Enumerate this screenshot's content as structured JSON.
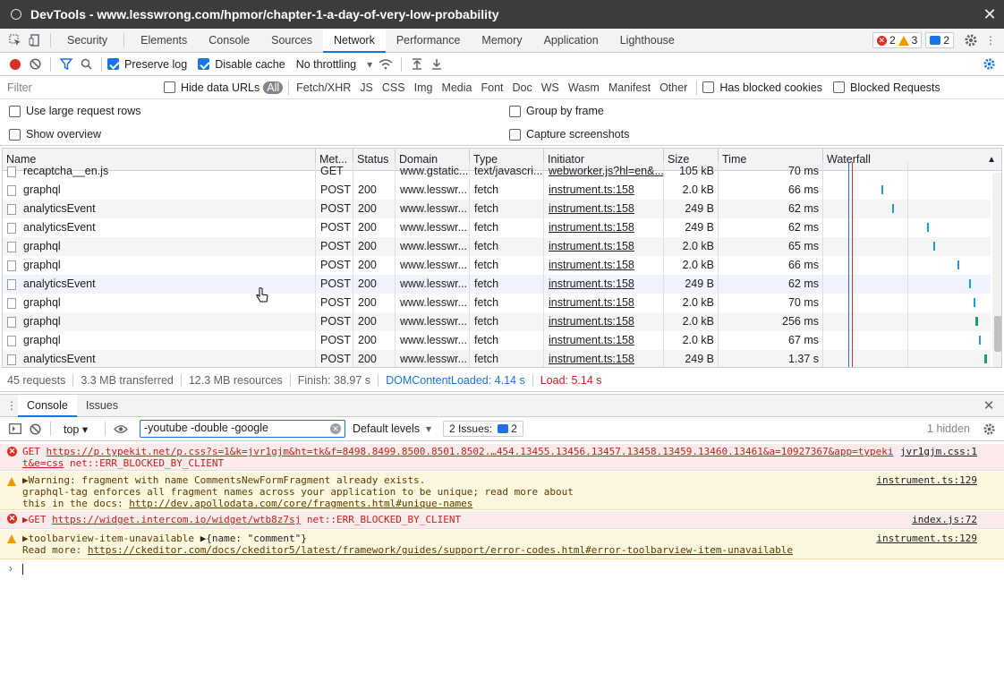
{
  "window": {
    "title": "DevTools - www.lesswrong.com/hpmor/chapter-1-a-day-of-very-low-probability"
  },
  "main_tabs": [
    "Security",
    "Elements",
    "Console",
    "Sources",
    "Network",
    "Performance",
    "Memory",
    "Application",
    "Lighthouse"
  ],
  "active_tab": "Network",
  "badges": {
    "errors": "2",
    "warnings": "3",
    "messages": "2"
  },
  "net_toolbar": {
    "preserve_log": "Preserve log",
    "disable_cache": "Disable cache",
    "throttling": "No throttling"
  },
  "filter_bar": {
    "placeholder": "Filter",
    "hide_data_urls": "Hide data URLs",
    "types": [
      "All",
      "Fetch/XHR",
      "JS",
      "CSS",
      "Img",
      "Media",
      "Font",
      "Doc",
      "WS",
      "Wasm",
      "Manifest",
      "Other"
    ],
    "has_blocked_cookies": "Has blocked cookies",
    "blocked_requests": "Blocked Requests"
  },
  "options": {
    "large_rows": "Use large request rows",
    "show_overview": "Show overview",
    "group_by_frame": "Group by frame",
    "capture_screenshots": "Capture screenshots"
  },
  "columns": [
    "Name",
    "Met...",
    "Status",
    "Domain",
    "Type",
    "Initiator",
    "Size",
    "Time",
    "Waterfall"
  ],
  "partial_row": {
    "name": "recaptcha__en.js",
    "method": "GET",
    "domain": "www.gstatic...",
    "type": "text/javascri...",
    "initiator": "webworker.js?hl=en&...",
    "size": "105 kB",
    "time": "70 ms"
  },
  "rows": [
    {
      "name": "graphql",
      "method": "POST",
      "status": "200",
      "domain": "www.lesswr...",
      "type": "fetch",
      "initiator": "instrument.ts:158",
      "size": "2.0 kB",
      "time": "66 ms",
      "wf": 0.35,
      "wc": "b"
    },
    {
      "name": "analyticsEvent",
      "method": "POST",
      "status": "200",
      "domain": "www.lesswr...",
      "type": "fetch",
      "initiator": "instrument.ts:158",
      "size": "249 B",
      "time": "62 ms",
      "wf": 0.41,
      "wc": "b"
    },
    {
      "name": "analyticsEvent",
      "method": "POST",
      "status": "200",
      "domain": "www.lesswr...",
      "type": "fetch",
      "initiator": "instrument.ts:158",
      "size": "249 B",
      "time": "62 ms",
      "wf": 0.62,
      "wc": "b"
    },
    {
      "name": "graphql",
      "method": "POST",
      "status": "200",
      "domain": "www.lesswr...",
      "type": "fetch",
      "initiator": "instrument.ts:158",
      "size": "2.0 kB",
      "time": "65 ms",
      "wf": 0.66,
      "wc": "b"
    },
    {
      "name": "graphql",
      "method": "POST",
      "status": "200",
      "domain": "www.lesswr...",
      "type": "fetch",
      "initiator": "instrument.ts:158",
      "size": "2.0 kB",
      "time": "66 ms",
      "wf": 0.8,
      "wc": "b"
    },
    {
      "name": "analyticsEvent",
      "method": "POST",
      "status": "200",
      "domain": "www.lesswr...",
      "type": "fetch",
      "initiator": "instrument.ts:158",
      "size": "249 B",
      "time": "62 ms",
      "wf": 0.87,
      "wc": "b"
    },
    {
      "name": "graphql",
      "method": "POST",
      "status": "200",
      "domain": "www.lesswr...",
      "type": "fetch",
      "initiator": "instrument.ts:158",
      "size": "2.0 kB",
      "time": "70 ms",
      "wf": 0.9,
      "wc": "b"
    },
    {
      "name": "graphql",
      "method": "POST",
      "status": "200",
      "domain": "www.lesswr...",
      "type": "fetch",
      "initiator": "instrument.ts:158",
      "size": "2.0 kB",
      "time": "256 ms",
      "wf": 0.91,
      "wc": "g"
    },
    {
      "name": "graphql",
      "method": "POST",
      "status": "200",
      "domain": "www.lesswr...",
      "type": "fetch",
      "initiator": "instrument.ts:158",
      "size": "2.0 kB",
      "time": "67 ms",
      "wf": 0.93,
      "wc": "b"
    },
    {
      "name": "analyticsEvent",
      "method": "POST",
      "status": "200",
      "domain": "www.lesswr...",
      "type": "fetch",
      "initiator": "instrument.ts:158",
      "size": "249 B",
      "time": "1.37 s",
      "wf": 0.96,
      "wc": "g"
    }
  ],
  "summary": {
    "requests": "45 requests",
    "transferred": "3.3 MB transferred",
    "resources": "12.3 MB resources",
    "finish": "Finish: 38.97 s",
    "dcl": "DOMContentLoaded: 4.14 s",
    "load": "Load: 5.14 s"
  },
  "drawer_tabs": [
    "Console",
    "Issues"
  ],
  "console_toolbar": {
    "context": "top",
    "filter": "-youtube -double -google",
    "levels": "Default levels",
    "issues": "2 Issues:",
    "issues_count": "2",
    "hidden": "1 hidden"
  },
  "console": {
    "m1": {
      "prefix": "GET ",
      "url": "https://p.typekit.net/p.css?s=1&k=jvr1gjm&ht=tk&f=8498.8499.8500.8501.8502.…454.13455.13456.13457.13458.13459.13460.13461&a=10927367&app=typeki",
      "url2": "t&e=css",
      "tail": " net::ERR_BLOCKED_BY_CLIENT",
      "src": "jvr1gjm.css:1"
    },
    "m2": {
      "l1": "▶Warning: fragment with name CommentsNewFormFragment already exists.",
      "l2": "graphql-tag enforces all fragment names across your application to be unique; read more about",
      "l3": "this in the docs: ",
      "link": "http://dev.apollodata.com/core/fragments.html#unique-names",
      "src": "instrument.ts:129"
    },
    "m3": {
      "prefix": "▶GET ",
      "url": "https://widget.intercom.io/widget/wtb8z7sj",
      "tail": " net::ERR_BLOCKED_BY_CLIENT",
      "src": "index.js:72"
    },
    "m4": {
      "l1": "▶toolbarview-item-unavailable ",
      "obj": "▶{name: \"comment\"}",
      "l2": "Read more: ",
      "link": "https://ckeditor.com/docs/ckeditor5/latest/framework/guides/support/error-codes.html#error-toolbarview-item-unavailable",
      "src": "instrument.ts:129"
    }
  },
  "colors": {
    "accent": "#1a73e8",
    "error": "#d93025",
    "warning": "#f29900",
    "link_blue": "#1a73e8"
  }
}
